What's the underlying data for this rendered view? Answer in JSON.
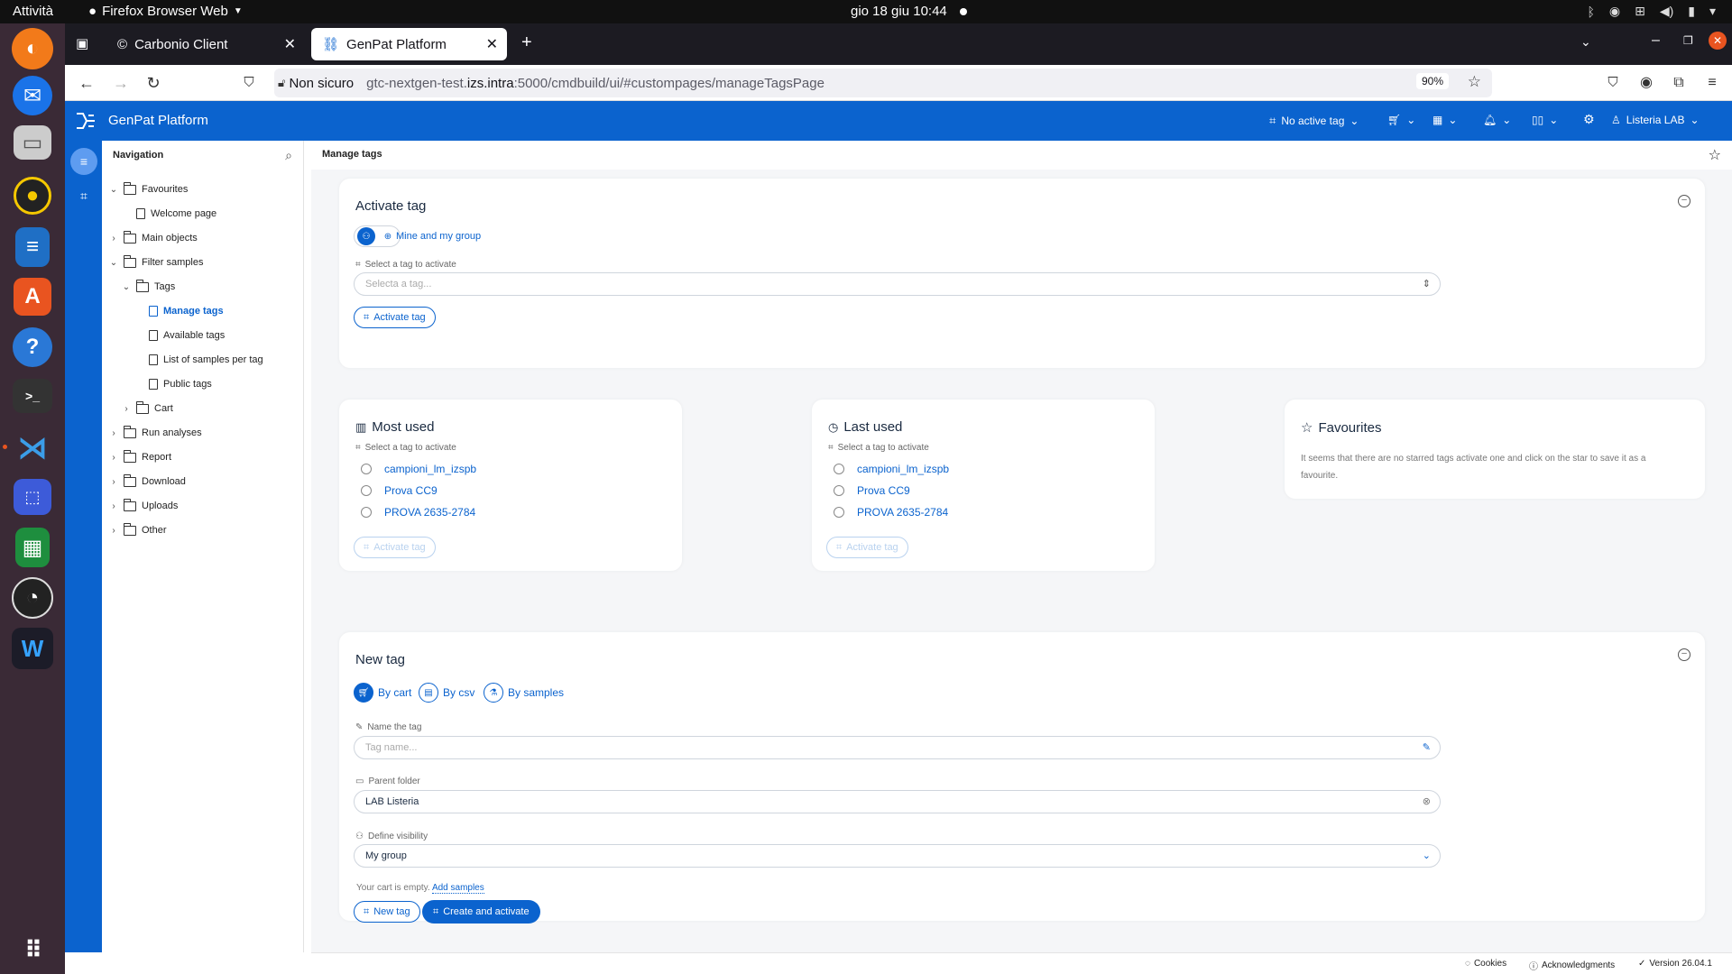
{
  "os": {
    "activities": "Attività",
    "app_name": "Firefox Browser Web",
    "clock": "gio 18 giu  10:44"
  },
  "browser": {
    "tabs": [
      {
        "label": "Carbonio Client",
        "active": false
      },
      {
        "label": "GenPat Platform",
        "active": true
      }
    ],
    "security": "Non sicuro",
    "url": "gtc-nextgen-test.izs.intra:5000/cmdbuild/ui/#custompages/manageTagsPage",
    "url_host": "gtc-nextgen-test.",
    "url_host_bold": "izs.intra",
    "url_rest": ":5000/cmdbuild/ui/#custompages/manageTagsPage",
    "zoom": "90%"
  },
  "header": {
    "title": "GenPat Platform",
    "active_tag": "No active tag",
    "user": "Listeria LAB"
  },
  "sidebar": {
    "title": "Navigation",
    "items": [
      {
        "label": "Favourites",
        "level": 0,
        "type": "folder",
        "chevron": "down"
      },
      {
        "label": "Welcome page",
        "level": 1,
        "type": "page",
        "chevron": ""
      },
      {
        "label": "Main objects",
        "level": 0,
        "type": "folder",
        "chevron": "right"
      },
      {
        "label": "Filter samples",
        "level": 0,
        "type": "folder",
        "chevron": "down"
      },
      {
        "label": "Tags",
        "level": 1,
        "type": "folder",
        "chevron": "down"
      },
      {
        "label": "Manage tags",
        "level": 2,
        "type": "page",
        "chevron": "",
        "active": true
      },
      {
        "label": "Available tags",
        "level": 2,
        "type": "doc",
        "chevron": ""
      },
      {
        "label": "List of samples per tag",
        "level": 2,
        "type": "doc",
        "chevron": ""
      },
      {
        "label": "Public tags",
        "level": 2,
        "type": "doc",
        "chevron": ""
      },
      {
        "label": "Cart",
        "level": 1,
        "type": "folder",
        "chevron": "right"
      },
      {
        "label": "Run analyses",
        "level": 0,
        "type": "folder",
        "chevron": "right"
      },
      {
        "label": "Report",
        "level": 0,
        "type": "folder",
        "chevron": "right"
      },
      {
        "label": "Download",
        "level": 0,
        "type": "folder",
        "chevron": "right"
      },
      {
        "label": "Uploads",
        "level": 0,
        "type": "folder",
        "chevron": "right"
      },
      {
        "label": "Other",
        "level": 0,
        "type": "folder",
        "chevron": "right"
      }
    ]
  },
  "breadcrumb": "Manage tags",
  "activate_card": {
    "title": "Activate tag",
    "scope_label": "Mine and my group",
    "field_label": "Select a tag to activate",
    "placeholder": "Selecta a tag...",
    "button": "Activate tag"
  },
  "most_used": {
    "title": "Most used",
    "field_label": "Select a tag to activate",
    "options": [
      "campioni_lm_izspb",
      "Prova CC9",
      "PROVA 2635-2784"
    ],
    "button": "Activate tag"
  },
  "last_used": {
    "title": "Last used",
    "field_label": "Select a tag to activate",
    "options": [
      "campioni_lm_izspb",
      "Prova CC9",
      "PROVA 2635-2784"
    ],
    "button": "Activate tag"
  },
  "favourites": {
    "title": "Favourites",
    "message": "It seems that there are no starred tags activate one and click on the star to save it as a favourite."
  },
  "new_tag": {
    "title": "New tag",
    "modes": [
      "By cart",
      "By csv",
      "By samples"
    ],
    "name_label": "Name the tag",
    "name_placeholder": "Tag name...",
    "parent_label": "Parent folder",
    "parent_value": "LAB Listeria",
    "visibility_label": "Define visibility",
    "visibility_value": "My group",
    "cart_empty": "Your cart is empty.",
    "add_samples": "Add samples",
    "button_new": "New tag",
    "button_create": "Create and activate"
  },
  "footer": {
    "cookies": "Cookies",
    "acknowledgments": "Acknowledgments",
    "version": "Version 26.04.1"
  },
  "colors": {
    "brand": "#0b63ce"
  }
}
